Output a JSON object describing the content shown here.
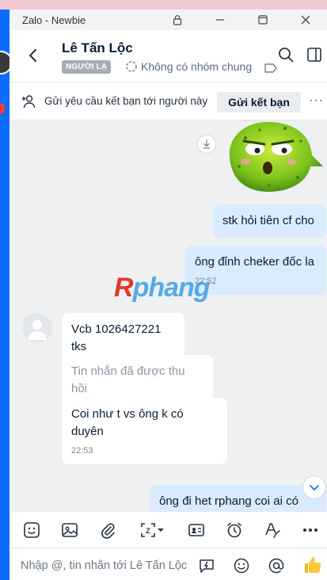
{
  "window": {
    "title": "Zalo - Newbie"
  },
  "header": {
    "contact_name": "Lê Tấn Lộc",
    "badge": "NGƯỜI LẠ",
    "group_info": "Không có nhóm chung"
  },
  "friend_request": {
    "text": "Gửi yêu cầu kết bạn tới người này",
    "button_label": "Gửi kết bạn"
  },
  "watermark": {
    "first": "R",
    "rest": "phang"
  },
  "messages": [
    {
      "sender": "me",
      "text": "stk hỏi tiên cf cho"
    },
    {
      "sender": "me",
      "text": "ông đỉnh cheker đốc la",
      "time": "22:52"
    },
    {
      "sender": "them",
      "text": "Vcb 1026427221 tks"
    },
    {
      "sender": "them",
      "text": "Tin nhắn đã được thu hồi",
      "recalled": true
    },
    {
      "sender": "them",
      "text": "Coi như t vs ông k có duyên",
      "time": "22:53"
    },
    {
      "sender": "me",
      "text": "ông đi het rphang coi ai có"
    }
  ],
  "input": {
    "placeholder": "Nhập @, tin nhắn tới Lê Tấn Lộc"
  },
  "colors": {
    "accent": "#0b6cff",
    "my_bubble": "#dbebff",
    "conversation_bg": "#eef0f1"
  },
  "icons": {
    "toolbar": [
      "sticker-icon",
      "image-icon",
      "attachment-icon",
      "screenshot-icon",
      "contact-card-icon",
      "reminder-icon",
      "text-format-icon",
      "more-icon"
    ],
    "input": [
      "quick-message-icon",
      "emoji-icon",
      "mention-icon",
      "thumbs-up-icon"
    ]
  }
}
